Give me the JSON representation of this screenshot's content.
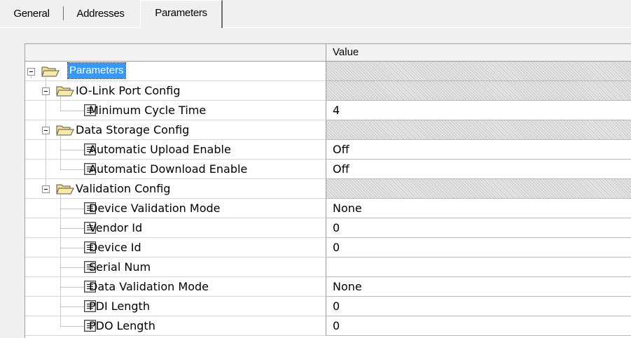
{
  "tabs": [
    {
      "label": "General",
      "active": false
    },
    {
      "label": "Addresses",
      "active": false
    },
    {
      "label": "Parameters",
      "active": true
    }
  ],
  "grid": {
    "value_header": "Value",
    "rows": [
      {
        "label": "Parameters",
        "value": "",
        "type": "folder",
        "level": 0,
        "expanded": true,
        "selected": true
      },
      {
        "label": "IO-Link Port Config",
        "value": "",
        "type": "folder",
        "level": 1,
        "expanded": true
      },
      {
        "label": "Minimum Cycle Time",
        "value": "4",
        "type": "param",
        "level": 2
      },
      {
        "label": "Data Storage Config",
        "value": "",
        "type": "folder",
        "level": 1,
        "expanded": true
      },
      {
        "label": "Automatic Upload Enable",
        "value": "Off",
        "type": "param",
        "level": 2
      },
      {
        "label": "Automatic Download Enable",
        "value": "Off",
        "type": "param",
        "level": 2
      },
      {
        "label": "Validation Config",
        "value": "",
        "type": "folder",
        "level": 1,
        "expanded": true
      },
      {
        "label": "Device Validation Mode",
        "value": "None",
        "type": "param",
        "level": 2
      },
      {
        "label": "Vendor Id",
        "value": "0",
        "type": "param",
        "level": 2
      },
      {
        "label": "Device Id",
        "value": "0",
        "type": "param",
        "level": 2
      },
      {
        "label": "Serial Num",
        "value": "",
        "type": "param",
        "level": 2
      },
      {
        "label": "Data Validation Mode",
        "value": "None",
        "type": "param",
        "level": 2
      },
      {
        "label": "PDI Length",
        "value": "0",
        "type": "param",
        "level": 2
      },
      {
        "label": "PDO Length",
        "value": "0",
        "type": "param",
        "level": 2
      }
    ]
  },
  "icons": {
    "folder": "folder-open-icon",
    "param": "parameter-icon",
    "expander": "collapse-minus-icon"
  },
  "colors": {
    "selection": "#3399ff",
    "folder_fill": "#f0d97a"
  }
}
